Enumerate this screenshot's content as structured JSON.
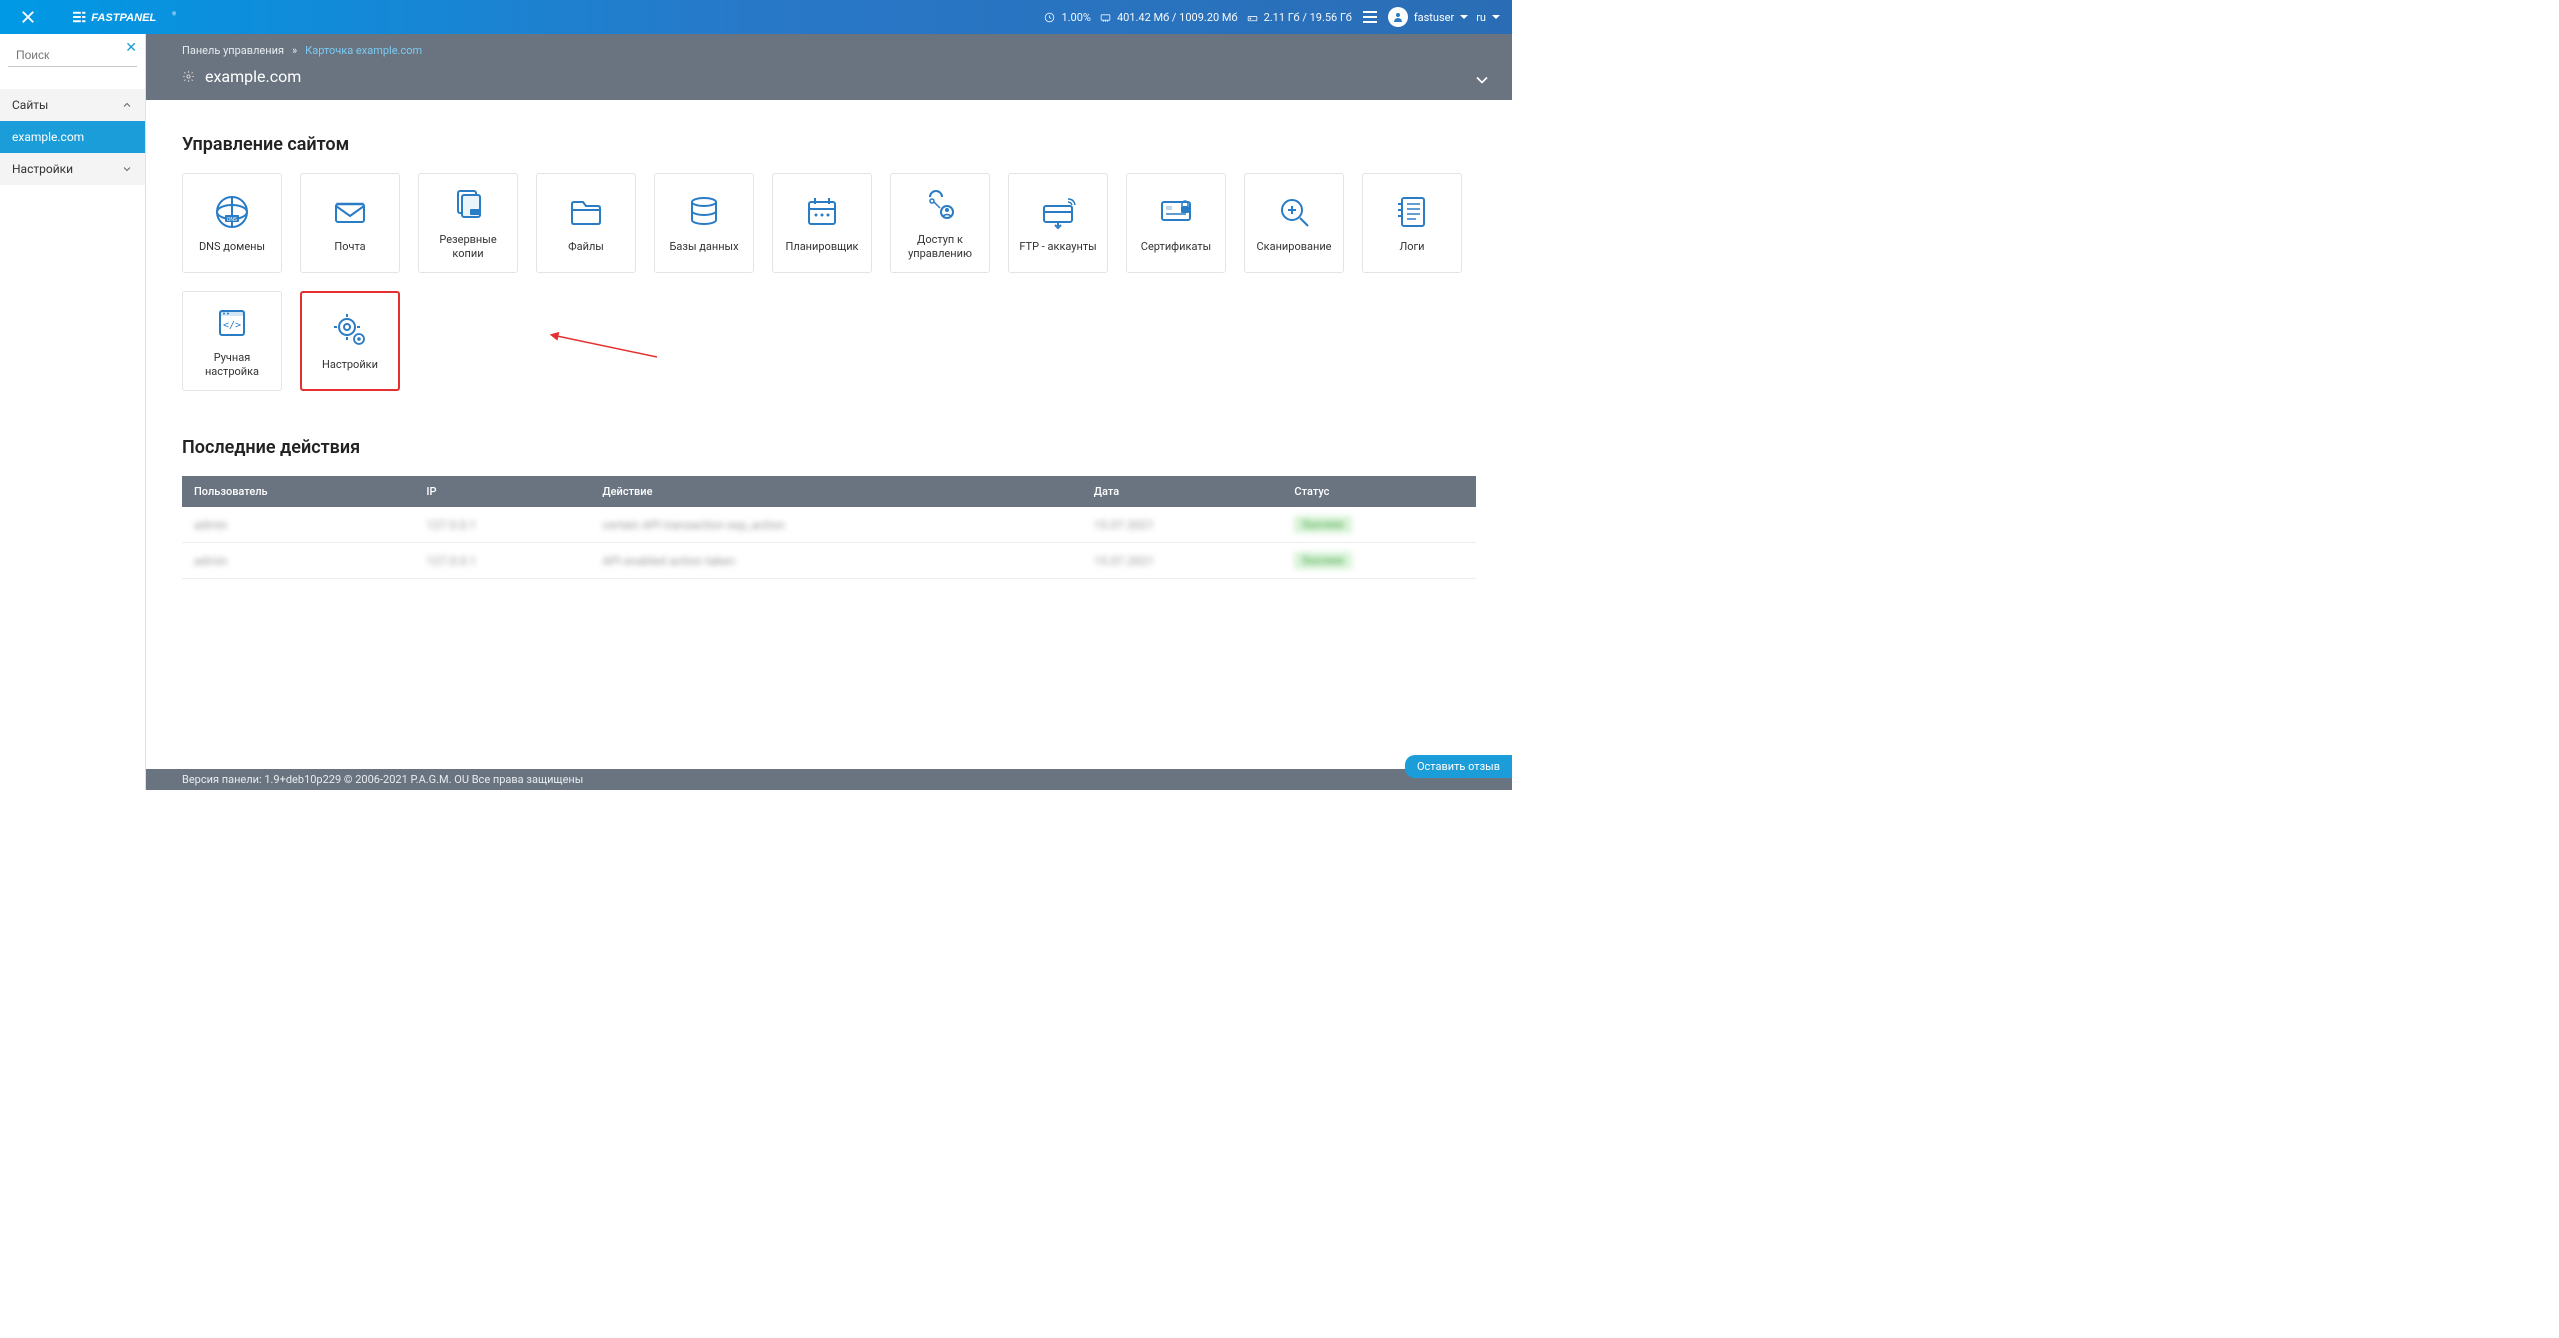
{
  "topbar": {
    "cpu_pct": "1.00%",
    "mem": "401.42 Мб / 1009.20 Мб",
    "disk": "2.11 Гб / 19.56 Гб",
    "user": "fastuser",
    "lang": "ru"
  },
  "sidebar": {
    "search_placeholder": "Поиск",
    "groups": [
      {
        "title": "Сайты",
        "expanded": true,
        "items": [
          "example.com"
        ]
      },
      {
        "title": "Настройки",
        "expanded": false,
        "items": []
      }
    ]
  },
  "breadcrumb": {
    "root": "Панель управления",
    "sep": "»",
    "current": "Карточка example.com"
  },
  "page_title": "example.com",
  "sections": {
    "manage": "Управление сайтом",
    "recent": "Последние действия"
  },
  "cards": [
    {
      "key": "dns",
      "label": "DNS домены"
    },
    {
      "key": "mail",
      "label": "Почта"
    },
    {
      "key": "backup",
      "label": "Резервные копии"
    },
    {
      "key": "files",
      "label": "Файлы"
    },
    {
      "key": "db",
      "label": "Базы данных"
    },
    {
      "key": "cron",
      "label": "Планировщик"
    },
    {
      "key": "access",
      "label": "Доступ к управлению"
    },
    {
      "key": "ftp",
      "label": "FTP - аккаунты"
    },
    {
      "key": "certs",
      "label": "Сертификаты"
    },
    {
      "key": "scan",
      "label": "Сканирование"
    },
    {
      "key": "logs",
      "label": "Логи"
    },
    {
      "key": "manual",
      "label": "Ручная настройка"
    },
    {
      "key": "settings",
      "label": "Настройки",
      "highlight": true
    }
  ],
  "table": {
    "headers": [
      "Пользователь",
      "IP",
      "Действие",
      "Дата",
      "Статус"
    ],
    "rows": [
      {
        "user": "admin",
        "ip": "127.0.0.1",
        "action": "certain API transaction exp_action",
        "date": "15.07.2021",
        "status": "Success"
      },
      {
        "user": "admin",
        "ip": "127.0.0.1",
        "action": "API enabled action taken",
        "date": "15.07.2021",
        "status": "Success"
      }
    ]
  },
  "footer": "Версия панели: 1.9+deb10p229 © 2006-2021 P.A.G.M. OU Все права защищены",
  "feedback": "Оставить отзыв"
}
